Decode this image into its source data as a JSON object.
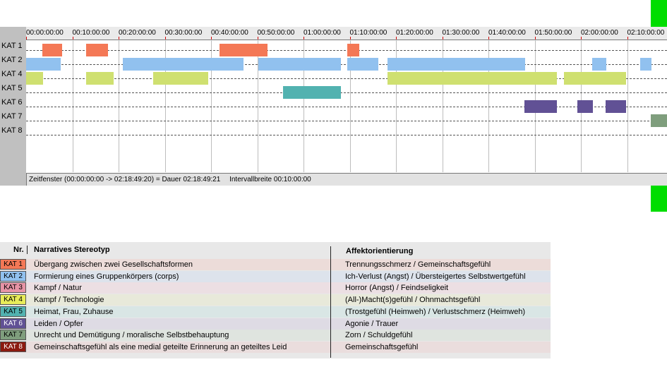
{
  "timeline": {
    "ticks": [
      "00:00:00:00",
      "00:10:00:00",
      "00:20:00:00",
      "00:30:00:00",
      "00:40:00:00",
      "00:50:00:00",
      "01:00:00:00",
      "01:10:00:00",
      "01:20:00:00",
      "01:30:00:00",
      "01:40:00:00",
      "01:50:00:00",
      "02:00:00:00",
      "02:10:00:00"
    ],
    "rows": [
      {
        "label": "KAT 1",
        "color": "#f47856",
        "segments": [
          [
            23,
            51
          ],
          [
            85,
            116
          ],
          [
            274,
            342
          ],
          [
            455,
            472
          ]
        ]
      },
      {
        "label": "KAT 2",
        "color": "#91c1ef",
        "segments": [
          [
            0,
            49
          ],
          [
            137,
            308
          ],
          [
            329,
            446
          ],
          [
            455,
            499
          ],
          [
            512,
            707
          ],
          [
            802,
            822
          ],
          [
            870,
            886
          ]
        ]
      },
      {
        "label": "KAT 4",
        "color": "#cfe070",
        "segments": [
          [
            0,
            24
          ],
          [
            85,
            124
          ],
          [
            180,
            258
          ],
          [
            512,
            752
          ],
          [
            762,
            850
          ]
        ]
      },
      {
        "label": "KAT 5",
        "color": "#52b2b0",
        "segments": [
          [
            364,
            446
          ]
        ]
      },
      {
        "label": "KAT 6",
        "color": "#615195",
        "segments": [
          [
            706,
            752
          ],
          [
            781,
            803
          ],
          [
            821,
            850
          ]
        ]
      },
      {
        "label": "KAT 7",
        "color": "#7f9e7d",
        "segments": [
          [
            885,
            908
          ]
        ]
      },
      {
        "label": "KAT 8",
        "color": "#8b1a10",
        "segments": []
      }
    ],
    "status": {
      "zeitfenster": "Zeitfenster (00:00:00:00 -> 02:18:49:20) = Dauer 02:18:49:21",
      "intervall": "Intervallbreite 00:10:00:00"
    }
  },
  "legend": {
    "headers": {
      "nr": "Nr.",
      "stereotyp": "Narratives Stereotyp",
      "affekt": "Affektorientierung"
    },
    "rows": [
      {
        "kat": "KAT 1",
        "badge": "#f47856",
        "bg": "#ecdcd9",
        "stereotyp": "Übergang zwischen zwei Gesellschaftsformen",
        "affekt": "Trennungsschmerz / Gemeinschaftsgefühl"
      },
      {
        "kat": "KAT 2",
        "badge": "#91c1ef",
        "bg": "#dde3ec",
        "stereotyp": "Formierung eines Gruppenkörpers (corps)",
        "affekt": "Ich-Verlust (Angst) / Übersteigertes Selbstwertgefühl"
      },
      {
        "kat": "KAT 3",
        "badge": "#e794a6",
        "bg": "#ecdfe3",
        "stereotyp": "Kampf / Natur",
        "affekt": "Horror (Angst) / Feindseligkeit"
      },
      {
        "kat": "KAT 4",
        "badge": "#e8ec5a",
        "bg": "#e8e9da",
        "stereotyp": "Kampf / Technologie",
        "affekt": "(All-)Macht(s)gefühl / Ohnmachtsgefühl"
      },
      {
        "kat": "KAT 5",
        "badge": "#52b2b0",
        "bg": "#d9e6e5",
        "stereotyp": "Heimat, Frau, Zuhause",
        "affekt": "(Trostgefühl (Heimweh) / Verlustschmerz (Heimweh)"
      },
      {
        "kat": "KAT 6",
        "badge": "#615195",
        "bg": "#dedbe4",
        "stereotyp": "Leiden / Opfer",
        "affekt": "Agonie / Trauer"
      },
      {
        "kat": "KAT 7",
        "badge": "#7f9e7d",
        "bg": "#dfe4df",
        "stereotyp": "Unrecht und Demütigung / moralische Selbstbehauptung",
        "affekt": "Zorn / Schuldgefühl"
      },
      {
        "kat": "KAT 8",
        "badge": "#8b1a10",
        "bg": "#eadddd",
        "stereotyp": "Gemeinschaftsgefühl als eine medial geteilte Erinnerung an geteiltes Leid",
        "affekt": "Gemeinschaftsgefühl"
      }
    ]
  }
}
